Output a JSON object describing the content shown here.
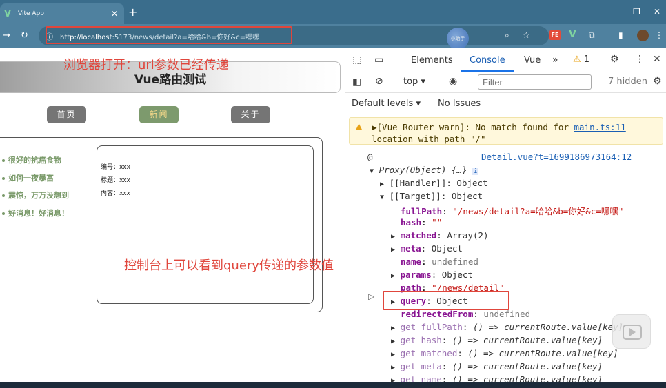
{
  "browser": {
    "tab_title": "Vite App",
    "new_tab": "+",
    "url_host": "http://localhost",
    "url_rest": ":5173/news/detail?a=哈哈&b=你好&c=嘿嘿",
    "bubble_text": "小助手"
  },
  "page": {
    "annotation_top": "浏览器打开：url参数已经传递",
    "header_title": "Vue路由测试",
    "nav": [
      {
        "label": "首页"
      },
      {
        "label": "新闻"
      },
      {
        "label": "关于"
      }
    ],
    "news": [
      "很好的抗癌食物",
      "如何一夜暴富",
      "震惊，万万没想到",
      "好消息！好消息！"
    ],
    "detail": {
      "id_line": "编号：xxx",
      "title_line": "标题：xxx",
      "content_line": "内容：xxx"
    },
    "annotation_bottom": "控制台上可以看到query传递的参数值"
  },
  "devtools": {
    "tabs": [
      "Elements",
      "Console",
      "Vue"
    ],
    "active_tab": "Console",
    "warning_count": "1",
    "context": "top",
    "filter_placeholder": "Filter",
    "hidden": "7 hidden",
    "default_levels": "Default levels",
    "no_issues": "No Issues",
    "warn": {
      "line1_prefix": "▶[Vue Router warn]: No match found for ",
      "line1_link": "main.ts:11",
      "line2": "location with path \"/\""
    },
    "log": {
      "at": "@",
      "source_link": "Detail.vue?t=1699186973164:12",
      "proxy": "Proxy(Object) {…}",
      "handler": "[[Handler]]: Object",
      "target": "[[Target]]: Object",
      "fullPath_key": "fullPath",
      "fullPath_val": "\"/news/detail?a=哈哈&b=你好&c=嘿嘿\"",
      "hash_key": "hash",
      "hash_val": "\"\"",
      "matched_key": "matched",
      "matched_val": "Array(2)",
      "meta_key": "meta",
      "meta_val": "Object",
      "name_key": "name",
      "name_val": "undefined",
      "params_key": "params",
      "params_val": "Object",
      "path_key": "path",
      "path_val": "\"/news/detail\"",
      "query_key": "query",
      "query_val": "Object",
      "redirectedFrom_key": "redirectedFrom",
      "redirectedFrom_val": "undefined",
      "getters": [
        {
          "key": "get fullPath",
          "val": "() => currentRoute.value[key]"
        },
        {
          "key": "get hash",
          "val": "() => currentRoute.value[key]"
        },
        {
          "key": "get matched",
          "val": "() => currentRoute.value[key]"
        },
        {
          "key": "get meta",
          "val": "() => currentRoute.value[key]"
        },
        {
          "key": "get name",
          "val": "() => currentRoute.value[key]"
        }
      ]
    }
  },
  "colors": {
    "annotation": "#e0463c",
    "chrome": "#4f819f",
    "link": "#1a5fb4"
  }
}
